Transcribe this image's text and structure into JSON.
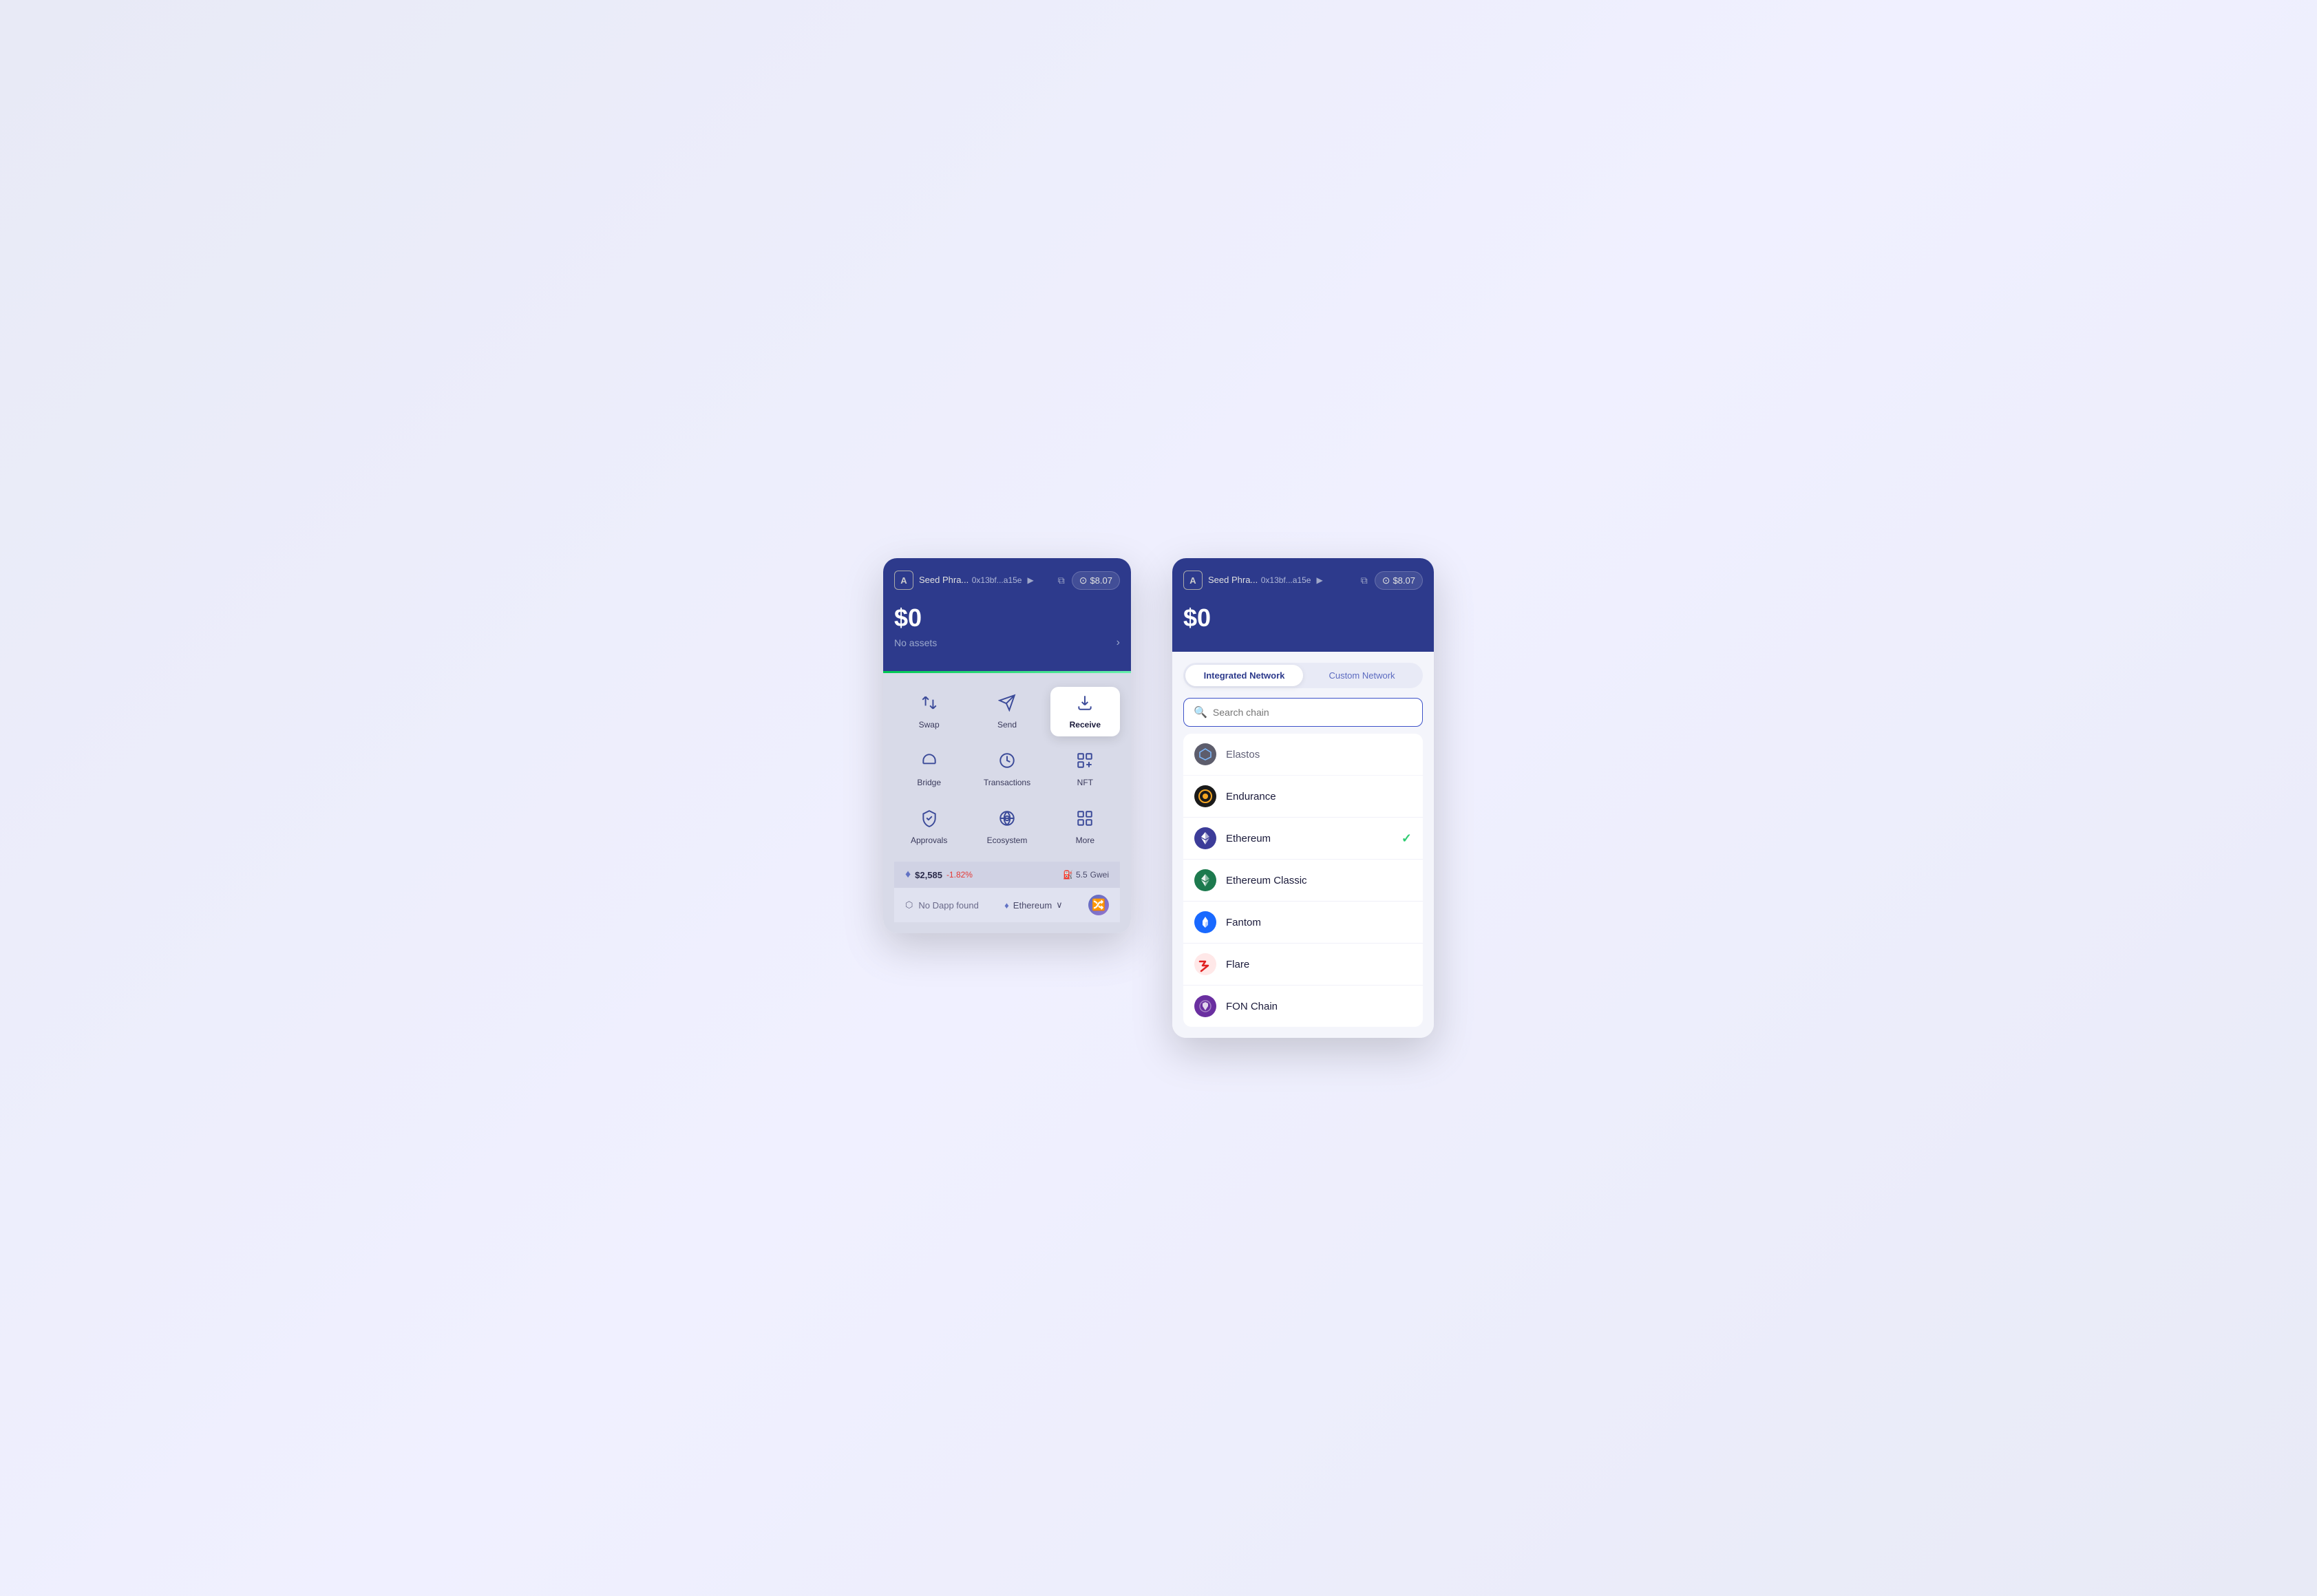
{
  "leftPanel": {
    "header": {
      "avatarLabel": "A",
      "accountName": "Seed Phra...",
      "accountAddress": "0x13bf...a15e",
      "balance": "$8.07",
      "totalBalance": "$0",
      "noAssetsText": "No assets"
    },
    "actions": [
      {
        "id": "swap",
        "label": "Swap",
        "icon": "swap"
      },
      {
        "id": "send",
        "label": "Send",
        "icon": "send"
      },
      {
        "id": "receive",
        "label": "Receive",
        "icon": "receive",
        "highlighted": true
      },
      {
        "id": "bridge",
        "label": "Bridge",
        "icon": "bridge"
      },
      {
        "id": "transactions",
        "label": "Transactions",
        "icon": "transactions"
      },
      {
        "id": "nft",
        "label": "NFT",
        "icon": "nft"
      },
      {
        "id": "approvals",
        "label": "Approvals",
        "icon": "approvals"
      },
      {
        "id": "ecosystem",
        "label": "Ecosystem",
        "icon": "ecosystem"
      },
      {
        "id": "more",
        "label": "More",
        "icon": "more"
      }
    ],
    "footer": {
      "ethPrice": "$2,585",
      "ethChange": "-1.82%",
      "gasPrice": "5.5",
      "gasUnit": "Gwei"
    },
    "bottomNav": {
      "dappText": "No Dapp found",
      "networkText": "Ethereum"
    }
  },
  "rightPanel": {
    "header": {
      "avatarLabel": "A",
      "accountName": "Seed Phra...",
      "accountAddress": "0x13bf...a15e",
      "balance": "$8.07",
      "totalBalance": "$0"
    },
    "tabs": [
      {
        "id": "integrated",
        "label": "Integrated Network",
        "active": true
      },
      {
        "id": "custom",
        "label": "Custom Network",
        "active": false
      }
    ],
    "search": {
      "placeholder": "Search chain"
    },
    "networks": [
      {
        "id": "elastos",
        "name": "Elastos",
        "logoType": "elastos",
        "partial": true,
        "selected": false
      },
      {
        "id": "endurance",
        "name": "Endurance",
        "logoType": "endurance",
        "partial": false,
        "selected": false
      },
      {
        "id": "ethereum",
        "name": "Ethereum",
        "logoType": "ethereum",
        "partial": false,
        "selected": true
      },
      {
        "id": "ethereum-classic",
        "name": "Ethereum Classic",
        "logoType": "eth-classic",
        "partial": false,
        "selected": false
      },
      {
        "id": "fantom",
        "name": "Fantom",
        "logoType": "fantom",
        "partial": false,
        "selected": false
      },
      {
        "id": "flare",
        "name": "Flare",
        "logoType": "flare",
        "partial": false,
        "selected": false
      },
      {
        "id": "fon-chain",
        "name": "FON Chain",
        "logoType": "fon",
        "partial": false,
        "selected": false
      }
    ]
  }
}
